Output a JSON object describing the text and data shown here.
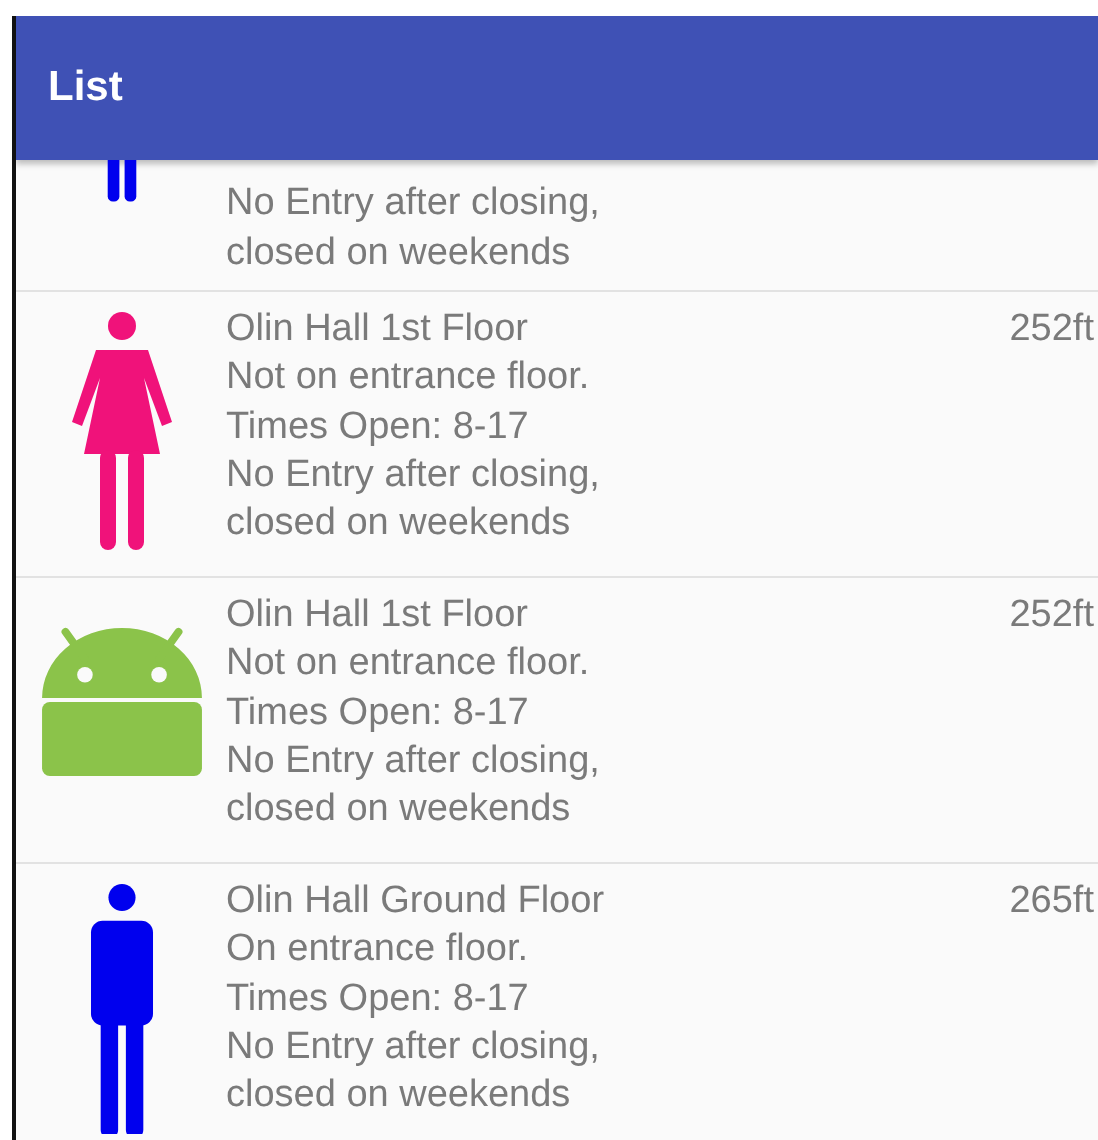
{
  "app_bar": {
    "title": "List"
  },
  "items": [
    {
      "kind": "male",
      "partial": true,
      "lines": [
        "No Entry after closing,",
        "closed on weekends"
      ]
    },
    {
      "kind": "female",
      "partial": false,
      "lines": [
        "Olin Hall 1st Floor",
        "Not on entrance floor.",
        "Times Open: 8-17",
        "No Entry after closing,",
        "closed on weekends"
      ],
      "distance": "252ft"
    },
    {
      "kind": "android",
      "partial": false,
      "lines": [
        "Olin Hall 1st Floor",
        "Not on entrance floor.",
        "Times Open: 8-17",
        "No Entry after closing,",
        "closed on weekends"
      ],
      "distance": "252ft"
    },
    {
      "kind": "male",
      "partial": false,
      "lines": [
        "Olin Hall Ground Floor",
        "On entrance floor.",
        "Times Open: 8-17",
        "No Entry after closing,",
        "closed on weekends"
      ],
      "distance": "265ft"
    }
  ]
}
